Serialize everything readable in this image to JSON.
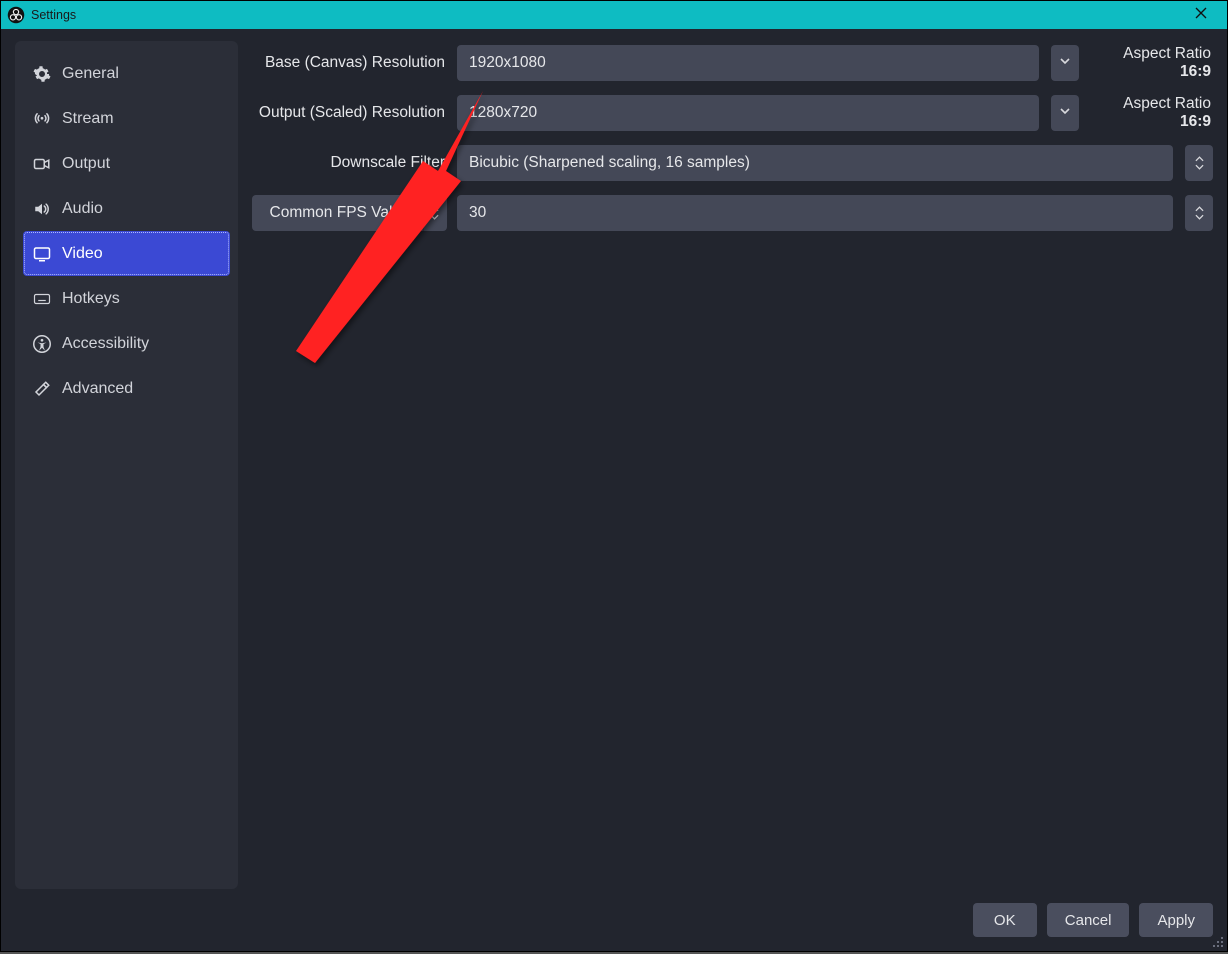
{
  "window": {
    "title": "Settings"
  },
  "sidebar": {
    "items": [
      {
        "id": "general",
        "label": "General"
      },
      {
        "id": "stream",
        "label": "Stream"
      },
      {
        "id": "output",
        "label": "Output"
      },
      {
        "id": "audio",
        "label": "Audio"
      },
      {
        "id": "video",
        "label": "Video"
      },
      {
        "id": "hotkeys",
        "label": "Hotkeys"
      },
      {
        "id": "accessibility",
        "label": "Accessibility"
      },
      {
        "id": "advanced",
        "label": "Advanced"
      }
    ],
    "selected": "video"
  },
  "video": {
    "base_label": "Base (Canvas) Resolution",
    "base_value": "1920x1080",
    "base_aspect_label": "Aspect Ratio ",
    "base_aspect_value": "16:9",
    "output_label": "Output (Scaled) Resolution",
    "output_value": "1280x720",
    "output_aspect_label": "Aspect Ratio ",
    "output_aspect_value": "16:9",
    "filter_label": "Downscale Filter",
    "filter_value": "Bicubic (Sharpened scaling, 16 samples)",
    "fps_mode_label": "Common FPS Values",
    "fps_value": "30"
  },
  "footer": {
    "ok": "OK",
    "cancel": "Cancel",
    "apply": "Apply"
  },
  "annotation": {
    "type": "arrow",
    "color": "#ff2b2b",
    "target": "output-resolution-combobox"
  }
}
